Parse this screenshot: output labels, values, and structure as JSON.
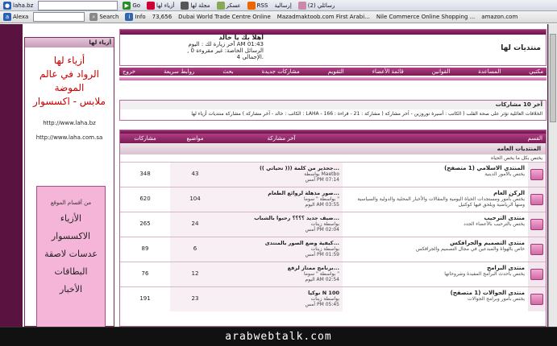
{
  "toolbar1": {
    "addr": "laha.bz",
    "go": "Go",
    "items": [
      "أزياء لها",
      "مجلة لها",
      "عسكر",
      "RSS",
      "إرسالية",
      "رسائلي (2)",
      "وصل حديثا",
      "أزياء",
      "بطاقات",
      "أزياء لها"
    ]
  },
  "toolbar2": {
    "alexa": "Alexa",
    "search": "Search",
    "info": "Info",
    "rank": "73,656",
    "links": [
      "Dubai World Trade Centre Online",
      "Mazadmaktoob.com First Arabi...",
      "Nile Commerce Online Shopping ..."
    ],
    "amazon": "amazon.com"
  },
  "sidebar": {
    "header": "أزياء لها",
    "ad_lines": [
      "أزياء لها",
      "الرواد في عالم",
      "الموضة",
      "ملابس - اكسسوار"
    ],
    "urls": [
      "http://www.laha.bz",
      "http://www.laha.com.sa"
    ],
    "sections_title": "من أقسام الموقع",
    "sections": [
      "الأزياء",
      "الاكسسوار",
      "عدسات لاصقة",
      "البطاقات",
      "الأخبار"
    ]
  },
  "header": {
    "site_name": "منتديات لها",
    "welcome_title": "أهلاً بك يا خالد",
    "last_visit": "آخر زيارة لك : اليوم AM 01:43",
    "messages": "الرسائل الخاصة: غير مقروءة 0 , الإجمالي 4."
  },
  "nav": [
    "مكتبي",
    "المساعدة",
    "القوانين",
    "قائمة الأعضاء",
    "التقويم",
    "مشاركات جديدة",
    "بحث",
    "روابط سريعة",
    "خروج"
  ],
  "latest": {
    "title": "آخر 10 مشاركات",
    "ticker": "مشاركة منتديات أزياء لها ( الكاتب : خالد - آخر مشاركة : LAHA - مشاركة : 21 - قراءة : 166 )      الخلافات العائلية تؤثر على صحة القلب ( الكاتب : أسيرة نوروزين - آخر مشاركة"
  },
  "forum_table": {
    "columns": [
      "القسم",
      "آخر مشاركة",
      "مواضيع",
      "مشاركات"
    ],
    "section_title": "المنتديات العامه",
    "section_desc": "يختص بكل ما يخص الحياه",
    "rows": [
      {
        "name": "المنتدى الاسلامي (1 متصفح)",
        "desc": "يختص بالأمور الدينية",
        "last_title": "جحذير من كلمة ((( تحياتي ))...",
        "last_by": "بواسطة Maetbo",
        "last_date": "أمس PM 07:14",
        "topics": "43",
        "posts": "348"
      },
      {
        "name": "الركن العام",
        "desc": "يختص بأمور ومستجدات الحياة اليومية والمقالات والأخبار المحلية والدولية والسياسية ومنها الرياضية ويلحق فيها كوكتيل",
        "last_title": "صور مذهلة لروائع الطعام...",
        "last_by": "بواسطة \" سوما \"",
        "last_date": "اليوم AM 03:55",
        "topics": "104",
        "posts": "620"
      },
      {
        "name": "منتدى الترحيب",
        "desc": "يختص بالترحيب بالأعضاء الجدد",
        "last_title": "ضيف جديد ؟؟؟؟ رحبوا بالشباب...",
        "last_by": "بواسطة زينات",
        "last_date": "أمس PM 02:04",
        "topics": "24",
        "posts": "265"
      },
      {
        "name": "منتدى التصميم والجرافكس",
        "desc": "خاص بالهواة والمبدعين في مجال التصميم والجرافكس",
        "last_title": "كيفية وضع الصور بالمنتدى...",
        "last_by": "بواسطة زينات",
        "last_date": "أمس PM 01:59",
        "topics": "6",
        "posts": "89"
      },
      {
        "name": "منتدى البرامج",
        "desc": "يختص بأحدث البرامج المفيدة وشروحاتها",
        "last_title": "برنامج ممتاز لرفع...",
        "last_by": "بواسطة \" سوما \"",
        "last_date": "اليوم AM 02:54",
        "topics": "12",
        "posts": "76"
      },
      {
        "name": "منتدى الجوالات (1 متصفح)",
        "desc": "يختص بأمور وبرامج الجوالات",
        "last_title": "نوكيا N 100",
        "last_by": "بواسطة زينات",
        "last_date": "أمس PM 05:45",
        "topics": "23",
        "posts": "191"
      }
    ]
  },
  "watermark": "arabwebtalk.com",
  "colors": {
    "frame": "#5a1340",
    "accent": "#9b2b6f",
    "pink": "#f5b5d9"
  }
}
